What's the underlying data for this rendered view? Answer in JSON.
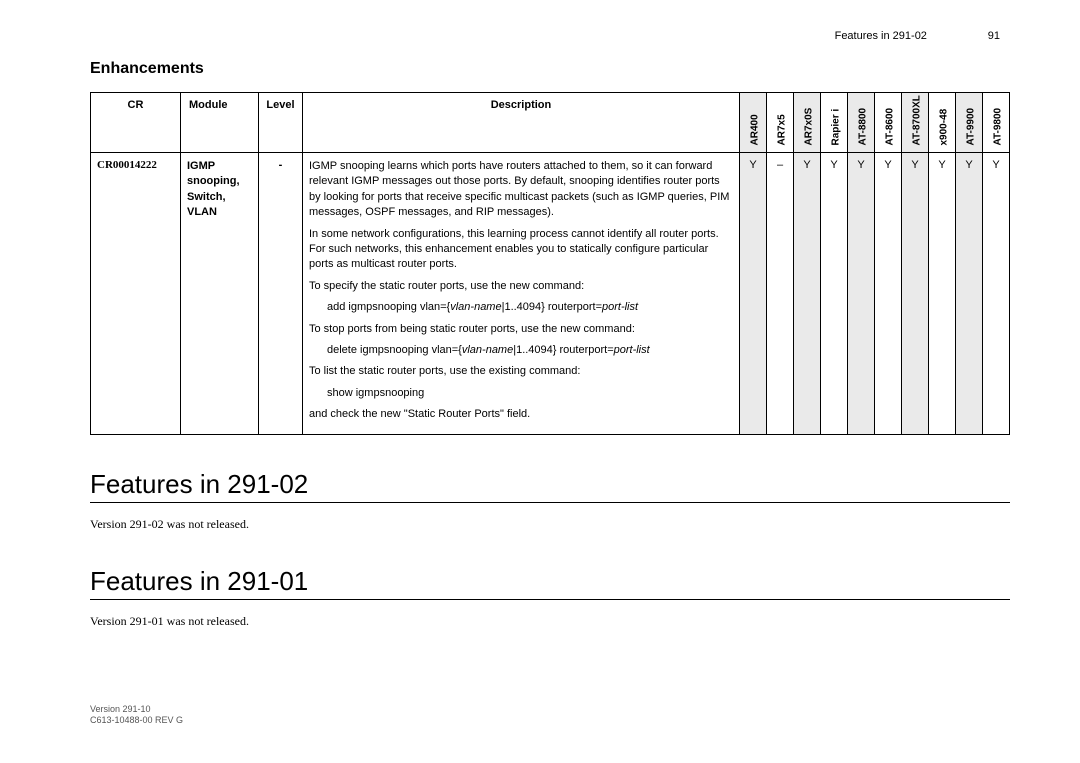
{
  "header": {
    "running": "Features in 291-02",
    "page_number": "91"
  },
  "section_title": "Enhancements",
  "columns": {
    "cr": "CR",
    "module": "Module",
    "level": "Level",
    "description": "Description",
    "devices": [
      "AR400",
      "AR7x5",
      "AR7x0S",
      "Rapier i",
      "AT-8800",
      "AT-8600",
      "AT-8700XL",
      "x900-48",
      "AT-9900",
      "AT-9800"
    ]
  },
  "row": {
    "cr": "CR00014222",
    "module": "IGMP snooping, Switch, VLAN",
    "level": "-",
    "desc": {
      "p1": "IGMP snooping learns which ports have routers attached to them, so it can forward relevant IGMP messages out those ports. By default, snooping identifies router ports by looking for ports that receive specific multicast packets (such as IGMP queries, PIM messages, OSPF messages, and RIP messages).",
      "p2": "In some network configurations, this learning process cannot identify all router ports. For such networks, this enhancement enables you to statically configure particular ports as multicast router ports.",
      "p3": "To specify the static router ports, use the new command:",
      "c1a": "add igmpsnooping vlan={",
      "c1b": "vlan-name",
      "c1c": "|1..4094} routerport=",
      "c1d": "port-list",
      "p4": "To stop ports from being static router ports, use the new command:",
      "c2a": "delete igmpsnooping vlan={",
      "c2b": "vlan-name",
      "c2c": "|1..4094} routerport=",
      "c2d": "port-list",
      "p5": "To list the static router ports, use the existing command:",
      "c3": "show igmpsnooping",
      "p6": "and check the new \"Static Router Ports\" field."
    },
    "support": [
      "Y",
      "–",
      "Y",
      "Y",
      "Y",
      "Y",
      "Y",
      "Y",
      "Y",
      "Y"
    ]
  },
  "sec2": {
    "heading": "Features in 291-02",
    "text": "Version 291-02 was not released."
  },
  "sec3": {
    "heading": "Features in 291-01",
    "text": "Version 291-01 was not released."
  },
  "footer": {
    "l1": "Version 291-10",
    "l2": "C613-10488-00 REV G"
  }
}
